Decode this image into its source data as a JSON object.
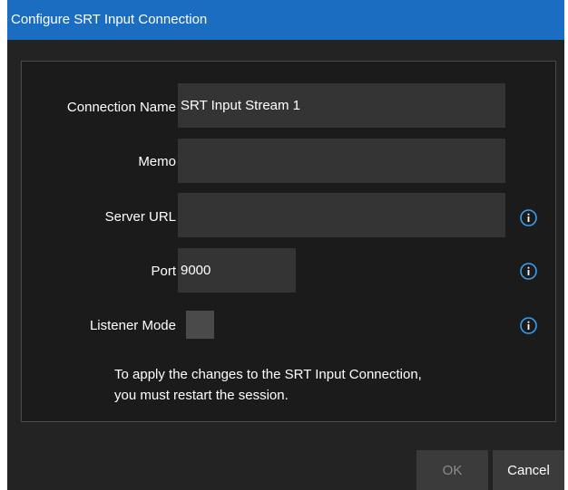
{
  "dialog": {
    "title": "Configure SRT Input Connection"
  },
  "form": {
    "connection_name": {
      "label": "Connection Name",
      "value": "SRT Input Stream 1"
    },
    "memo": {
      "label": "Memo",
      "value": ""
    },
    "server_url": {
      "label": "Server URL",
      "value": "",
      "info_icon": "info-icon"
    },
    "port": {
      "label": "Port",
      "value": "9000",
      "info_icon": "info-icon"
    },
    "listener_mode": {
      "label": "Listener Mode",
      "checked": false,
      "info_icon": "info-icon"
    }
  },
  "note": {
    "line1": "To apply the changes to the SRT Input Connection,",
    "line2": "you must restart the session."
  },
  "footer": {
    "ok_label": "OK",
    "cancel_label": "Cancel"
  },
  "colors": {
    "title_bar": "#1a6dc1",
    "info_icon": "#3a9ef0",
    "dialog_bg": "#232323",
    "panel_bg": "#1b1b1b",
    "field_bg": "#343434"
  }
}
